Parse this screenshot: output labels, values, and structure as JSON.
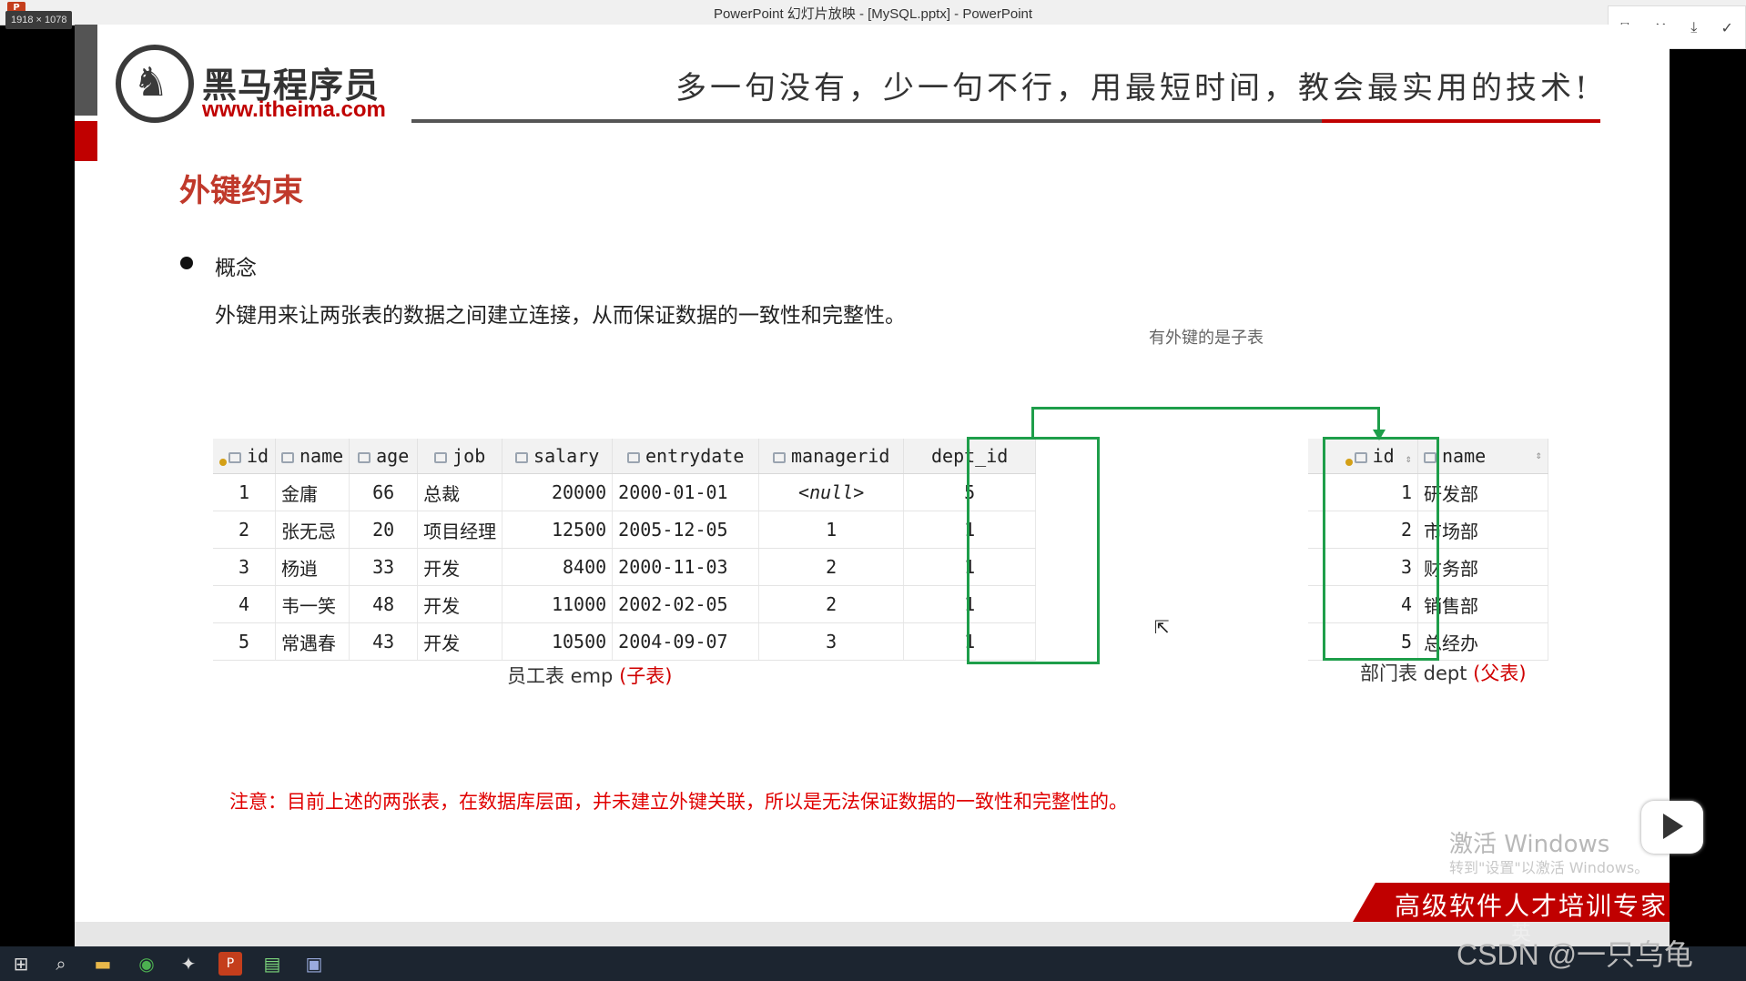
{
  "window": {
    "title": "PowerPoint 幻灯片放映 - [MySQL.pptx] - PowerPoint",
    "resolution_badge": "1918 × 1078",
    "app_icon": "P",
    "buttons": [
      "⧉",
      "✕",
      "⤓",
      "✓"
    ]
  },
  "slide": {
    "logo_cn": "黑马程序员",
    "logo_url": "www.itheima.com",
    "slogan": "多一句没有，少一句不行，用最短时间，教会最实用的技术!",
    "title": "外键约束",
    "bullet_label": "概念",
    "concept_text": "外键用来让两张表的数据之间建立连接，从而保证数据的一致性和完整性。",
    "child_note": "有外键的是子表",
    "emp_caption": "员工表 emp ",
    "emp_caption_tag": "(子表)",
    "dept_caption": "部门表 dept ",
    "dept_caption_tag": "(父表)",
    "note": "注意：目前上述的两张表，在数据库层面，并未建立外键关联，所以是无法保证数据的一致性和完整性的。",
    "banner": "高级软件人才培训专家",
    "activate_title": "激活 Windows",
    "activate_sub": "转到\"设置\"以激活 Windows。"
  },
  "emp_table": {
    "columns": [
      "id",
      "name",
      "age",
      "job",
      "salary",
      "entrydate",
      "managerid",
      "dept_id"
    ],
    "rows": [
      [
        "1",
        "金庸",
        "66",
        "总裁",
        "20000",
        "2000-01-01",
        "<null>",
        "5"
      ],
      [
        "2",
        "张无忌",
        "20",
        "项目经理",
        "12500",
        "2005-12-05",
        "1",
        "1"
      ],
      [
        "3",
        "杨逍",
        "33",
        "开发",
        "8400",
        "2000-11-03",
        "2",
        "1"
      ],
      [
        "4",
        "韦一笑",
        "48",
        "开发",
        "11000",
        "2002-02-05",
        "2",
        "1"
      ],
      [
        "5",
        "常遇春",
        "43",
        "开发",
        "10500",
        "2004-09-07",
        "3",
        "1"
      ]
    ]
  },
  "dept_table": {
    "columns": [
      "id",
      "name"
    ],
    "rows": [
      [
        "1",
        "研发部"
      ],
      [
        "2",
        "市场部"
      ],
      [
        "3",
        "财务部"
      ],
      [
        "4",
        "销售部"
      ],
      [
        "5",
        "总经办"
      ]
    ]
  },
  "overlay": {
    "csdn": "CSDN @一只乌龟",
    "tray": "英"
  },
  "colors": {
    "accent_red": "#c00000",
    "link_green": "#1e9e4a"
  }
}
